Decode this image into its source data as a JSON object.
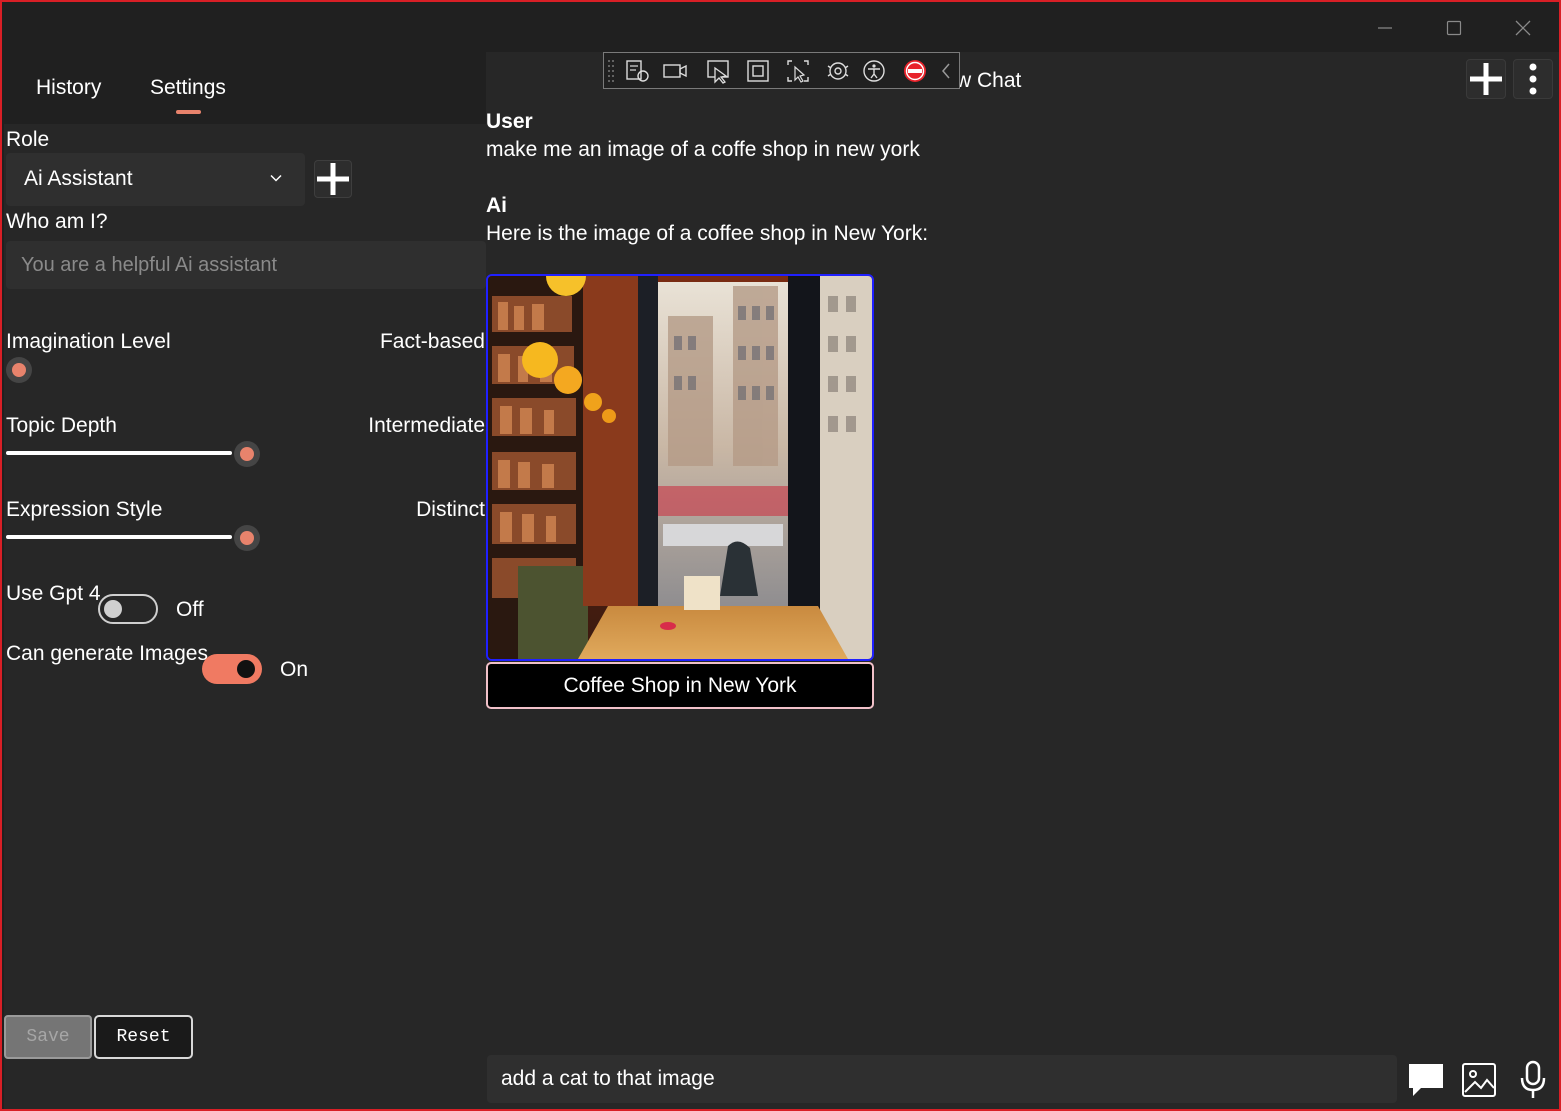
{
  "window": {
    "controls": {
      "minimize_icon": "minimize-icon",
      "maximize_icon": "maximize-icon",
      "close_icon": "close-icon"
    },
    "border_color": "#d81f26"
  },
  "left_panel": {
    "tabs": [
      {
        "label": "History",
        "selected": false
      },
      {
        "label": "Settings",
        "selected": true
      }
    ],
    "role": {
      "label": "Role",
      "selected_value": "Ai Assistant"
    },
    "who_am_i": {
      "label": "Who am I?",
      "placeholder": "You are a helpful Ai assistant",
      "value": ""
    },
    "sliders": {
      "imagination": {
        "label": "Imagination Level",
        "value_label": "Fact-based",
        "level": 0.0
      },
      "topic_depth": {
        "label": "Topic Depth",
        "value_label": "Intermediate",
        "level": 0.9
      },
      "expression": {
        "label": "Expression Style",
        "value_label": "Distinct",
        "level": 0.9
      }
    },
    "toggles": {
      "gpt4": {
        "label": "Use Gpt 4",
        "state_label": "Off",
        "on": false
      },
      "images": {
        "label": "Can generate Images",
        "state_label": "On",
        "on": true
      }
    },
    "buttons": {
      "save": "Save",
      "reset": "Reset"
    }
  },
  "chat": {
    "title_partial": "w Chat",
    "messages": [
      {
        "sender": "User",
        "text": "make me an image of a coffe shop in new york"
      },
      {
        "sender": "Ai",
        "text": "Here is the image of a coffee shop in New York:"
      }
    ],
    "image_caption": "Coffee Shop in New York",
    "input_value": "add a cat to that image",
    "icons": [
      "plus-icon",
      "more-vertical-icon",
      "chat-bubble-icon",
      "image-icon",
      "microphone-icon"
    ]
  },
  "toolbar": {
    "icons": [
      "grip-icon",
      "live-tree-icon",
      "video-camera-icon",
      "select-element-icon",
      "focus-box-icon",
      "select-region-icon",
      "track-focus-icon",
      "accessibility-icon",
      "stop-icon",
      "chevron-left-icon"
    ]
  },
  "colors": {
    "accent": "#e8836c",
    "toggle_on": "#f07a62",
    "image_border": "#2020ff"
  }
}
